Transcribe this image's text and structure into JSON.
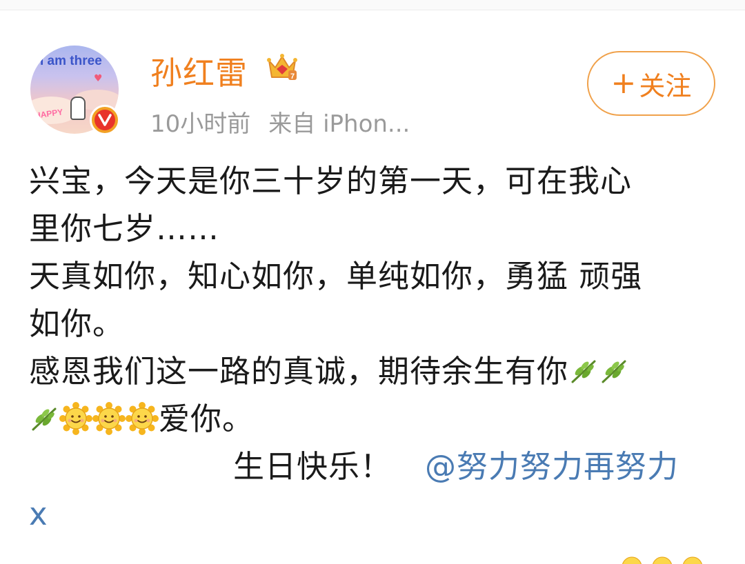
{
  "author": {
    "name": "孙红雷",
    "avatar_text": "I am three",
    "avatar_happy": "HAPPY",
    "badge_icon": "crown-icon",
    "verified_icon": "verified-v-icon"
  },
  "meta": {
    "time": "10小时前",
    "source": "来自 iPhon..."
  },
  "follow_button": {
    "label": "关注",
    "icon": "plus-icon"
  },
  "post": {
    "line1": "兴宝，今天是你三十岁的第一天，可在我心",
    "line2": "里你七岁……",
    "line3": "天真如你，知心如你，单纯如你，勇猛 顽强",
    "line4": "如你。",
    "line5": "感恩我们这一路的真诚，期待余生有你",
    "line6_text": "爱你。",
    "line7": "生日快乐！",
    "mention": "@努力努力再努力",
    "mention_tail": "x"
  },
  "colors": {
    "accent": "#f0801f",
    "mention": "#4a7bb3",
    "meta": "#9a9a9a"
  }
}
